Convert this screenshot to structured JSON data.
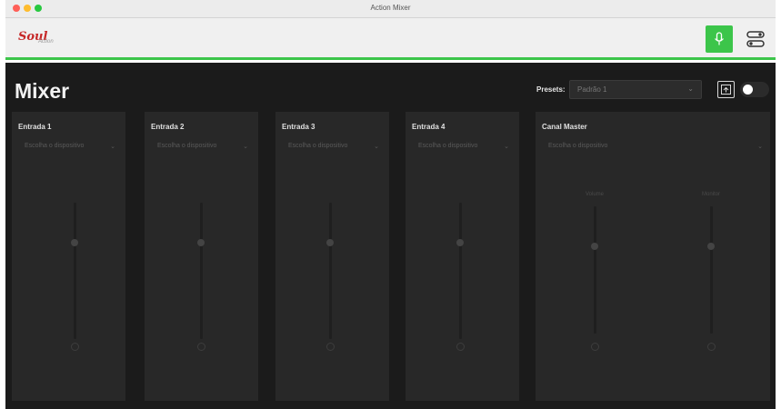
{
  "window": {
    "title": "Action Mixer"
  },
  "header": {
    "logo": "Soul",
    "logo_sub": "Action"
  },
  "toolbar": {
    "title": "Mixer",
    "presets_label": "Presets:",
    "preset_value": "Padrão 1",
    "toggle_on": true
  },
  "inputs": [
    {
      "label": "Entrada 1",
      "device_placeholder": "Escolha o dispositivo",
      "volume": 0.5
    },
    {
      "label": "Entrada 2",
      "device_placeholder": "Escolha o dispositivo",
      "volume": 0.5
    },
    {
      "label": "Entrada 3",
      "device_placeholder": "Escolha o dispositivo",
      "volume": 0.5
    },
    {
      "label": "Entrada 4",
      "device_placeholder": "Escolha o dispositivo",
      "volume": 0.5
    }
  ],
  "master": {
    "label": "Canal Master",
    "device_placeholder": "Escolha o dispositivo",
    "channels": [
      {
        "label": "Volume",
        "volume": 0.5
      },
      {
        "label": "Monitor",
        "volume": 0.5
      }
    ]
  },
  "colors": {
    "accent_green": "#3cc54a",
    "background": "#1b1b1b",
    "card": "#282828"
  },
  "icons": {
    "mic": "microphone-icon",
    "route": "routing-icon",
    "save": "save-preset-icon"
  }
}
